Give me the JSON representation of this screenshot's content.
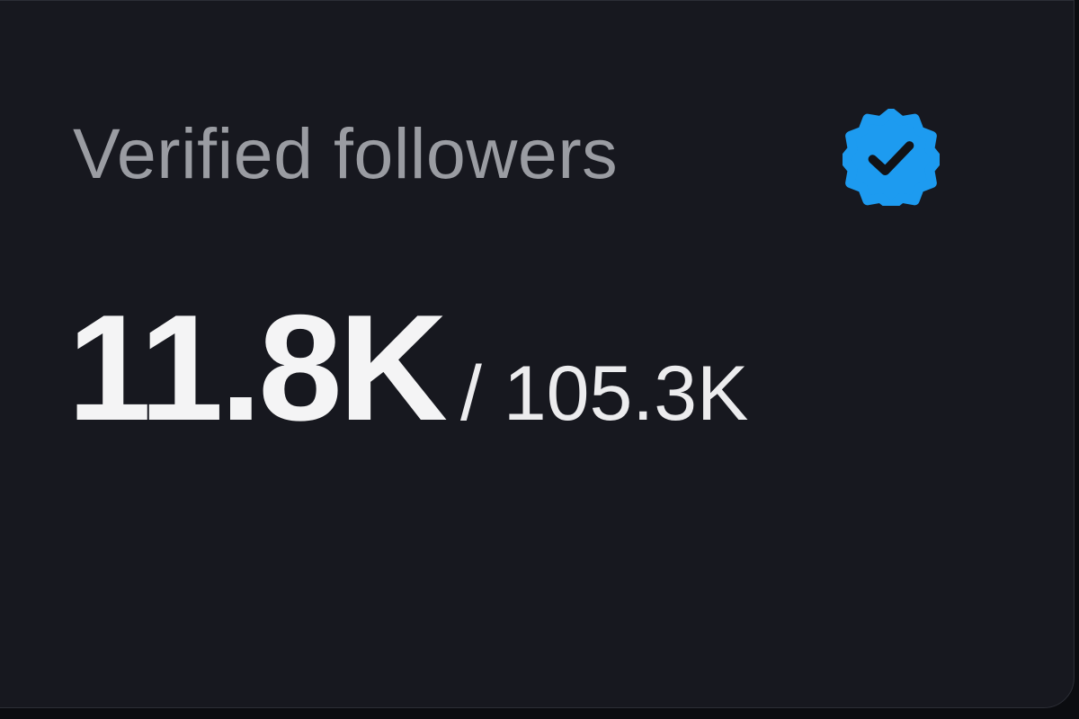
{
  "card": {
    "title": "Verified followers",
    "badge_icon": "verified-badge-icon",
    "value": "11.8K",
    "total": "/ 105.3K"
  },
  "colors": {
    "card_background": "#17181f",
    "title_text": "#9a9ca2",
    "value_text": "#f4f4f5",
    "badge_blue": "#1d9bf0"
  }
}
